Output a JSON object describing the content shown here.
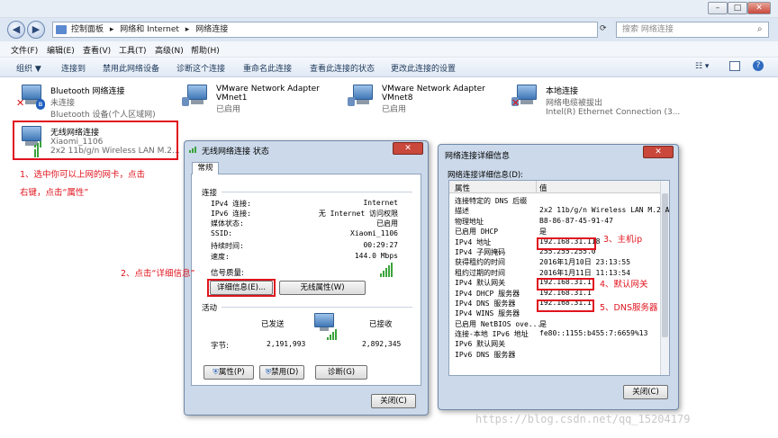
{
  "window": {
    "minimize": "–",
    "maximize": "□",
    "close": "✕"
  },
  "address": {
    "back": "◀",
    "forward": "▶",
    "crumbs": [
      "控制面板",
      "网络和 Internet",
      "网络连接"
    ],
    "separator": "▸",
    "search_placeholder": "搜索 网络连接"
  },
  "menu": [
    "文件(F)",
    "编辑(E)",
    "查看(V)",
    "工具(T)",
    "高级(N)",
    "帮助(H)"
  ],
  "toolbar": [
    "组织 ▼",
    "连接到",
    "禁用此网络设备",
    "诊断这个连接",
    "重命名此连接",
    "查看此连接的状态",
    "更改此连接的设置"
  ],
  "adapters": [
    {
      "name": "Bluetooth 网络连接",
      "line2": "未连接",
      "line3": "Bluetooth 设备(个人区域网)"
    },
    {
      "name": "VMware Network Adapter",
      "line2": "VMnet1",
      "line3": "已启用"
    },
    {
      "name": "VMware Network Adapter",
      "line2": "VMnet8",
      "line3": "已启用"
    },
    {
      "name": "本地连接",
      "line2": "网络电缆被拔出",
      "line3": "Intel(R) Ethernet Connection (3..."
    },
    {
      "name": "无线网络连接",
      "line2": "Xiaomi_1106",
      "line3": "2x2 11b/g/n Wireless LAN M.2..."
    }
  ],
  "annotations": {
    "step1_line1": "1、选中你可以上网的网卡，点击",
    "step1_line2": "右键，点击“属性”",
    "step2": "2、点击“详细信息”",
    "step3": "3、主机ip",
    "step4": "4、默认网关",
    "step5": "5、DNS服务器"
  },
  "status_dialog": {
    "title": "无线网络连接 状态",
    "tab": "常规",
    "section_connection": "连接",
    "rows": [
      {
        "label": "IPv4 连接:",
        "value": "Internet"
      },
      {
        "label": "IPv6 连接:",
        "value": "无 Internet 访问权限"
      },
      {
        "label": "媒体状态:",
        "value": "已启用"
      },
      {
        "label": "SSID:",
        "value": "Xiaomi_1106"
      },
      {
        "label": "持续时间:",
        "value": "00:29:27"
      },
      {
        "label": "速度:",
        "value": "144.0 Mbps"
      }
    ],
    "signal_label": "信号质量:",
    "details_button": "详细信息(E)...",
    "wireless_props_button": "无线属性(W)",
    "section_activity": "活动",
    "sent_label": "已发送",
    "recv_label": "已接收",
    "bytes_label": "字节:",
    "bytes_sent": "2,191,993",
    "bytes_recv": "2,892,345",
    "properties_button": "属性(P)",
    "disable_button": "禁用(D)",
    "diagnose_button": "诊断(G)",
    "close_button": "关闭(C)"
  },
  "details_dialog": {
    "title": "网络连接详细信息",
    "caption": "网络连接详细信息(D):",
    "col_property": "属性",
    "col_value": "值",
    "rows": [
      {
        "p": "连接特定的 DNS 后缀",
        "v": ""
      },
      {
        "p": "描述",
        "v": "2x2 11b/g/n Wireless LAN M.2 A"
      },
      {
        "p": "物理地址",
        "v": "B8-86-87-45-91-47"
      },
      {
        "p": "已启用 DHCP",
        "v": "是"
      },
      {
        "p": "IPv4 地址",
        "v": "192.168.31.118"
      },
      {
        "p": "IPv4 子网掩码",
        "v": "255.255.255.0"
      },
      {
        "p": "获得租约的时间",
        "v": "2016年1月10日 23:13:55"
      },
      {
        "p": "租约过期的时间",
        "v": "2016年1月11日 11:13:54"
      },
      {
        "p": "IPv4 默认网关",
        "v": "192.168.31.1"
      },
      {
        "p": "IPv4 DHCP 服务器",
        "v": "192.168.31.1"
      },
      {
        "p": "IPv4 DNS 服务器",
        "v": "192.168.31.1"
      },
      {
        "p": "IPv4 WINS 服务器",
        "v": ""
      },
      {
        "p": "已启用 NetBIOS ove...",
        "v": "是"
      },
      {
        "p": "连接-本地 IPv6 地址",
        "v": "fe80::1155:b455:7:6659%13"
      },
      {
        "p": "IPv6 默认网关",
        "v": ""
      },
      {
        "p": "IPv6 DNS 服务器",
        "v": ""
      }
    ],
    "close_button": "关闭(C)"
  },
  "watermark": "https://blog.csdn.net/qq_15204179"
}
